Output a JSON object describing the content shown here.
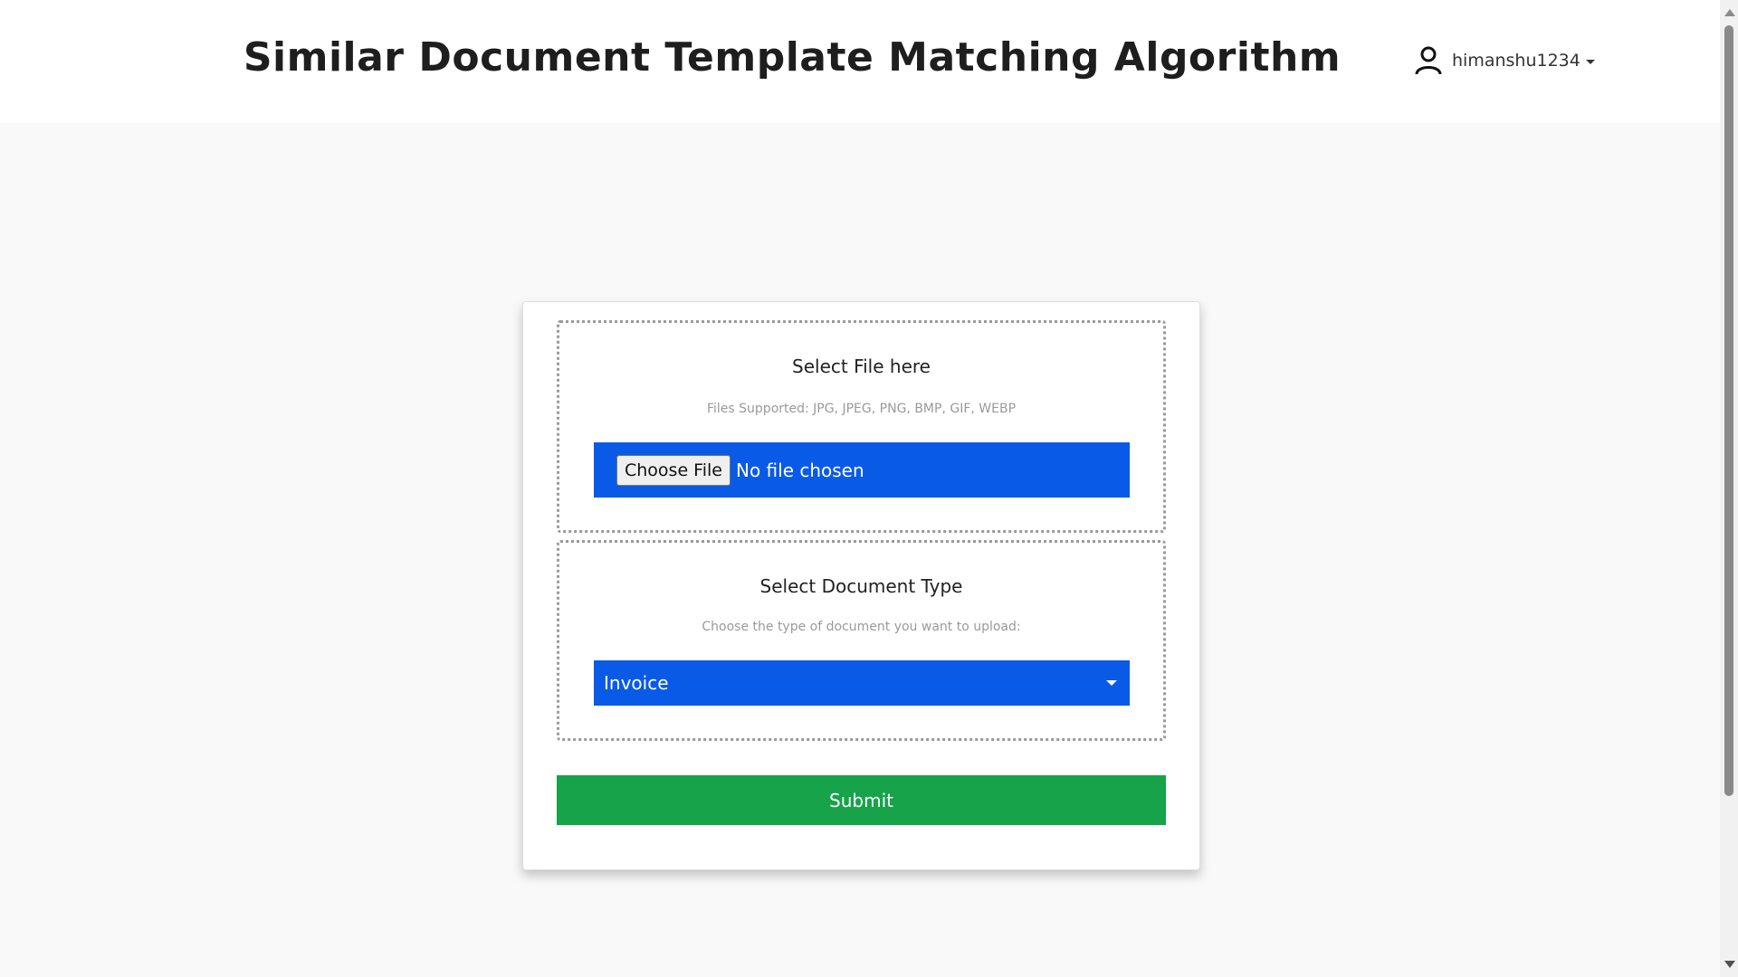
{
  "header": {
    "title": "Similar Document Template Matching Algorithm",
    "user": {
      "username": "himanshu1234",
      "icon": "user-icon"
    }
  },
  "upload": {
    "file_section": {
      "title": "Select File here",
      "hint": "Files Supported: JPG, JPEG, PNG, BMP, GIF, WEBP",
      "choose_button": "Choose File",
      "status": "No file chosen"
    },
    "doctype_section": {
      "title": "Select Document Type",
      "hint": "Choose the type of document you want to upload:",
      "selected": "Invoice"
    },
    "submit_label": "Submit"
  },
  "colors": {
    "accent_blue": "#0a5ae8",
    "submit_green": "#16a34a"
  }
}
